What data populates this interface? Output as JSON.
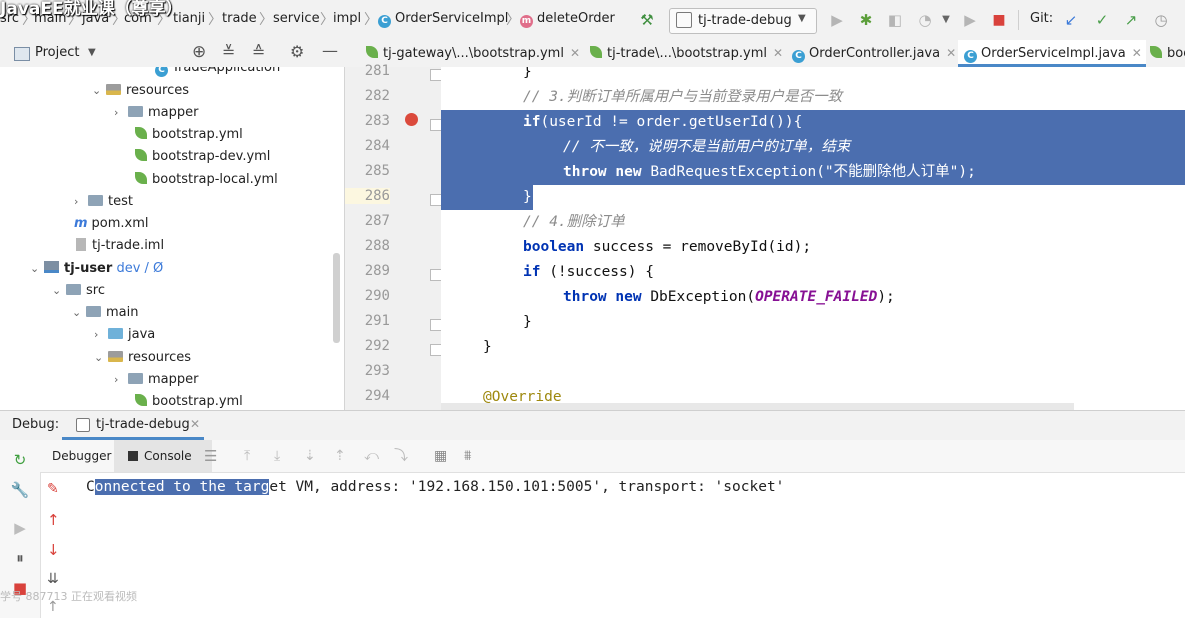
{
  "watermark": "JavaEE就业课（尊享）",
  "breadcrumb": [
    "src",
    "main",
    "java",
    "com",
    "tianji",
    "trade",
    "service",
    "impl",
    "OrderServiceImpl",
    "deleteOrder"
  ],
  "run_config": "tj-trade-debug",
  "vcs_label": "Git:",
  "project_panel": {
    "title": "Project",
    "tree": [
      {
        "label": "TradeApplication",
        "depth": 6
      },
      {
        "label": "resources",
        "depth": 5
      },
      {
        "label": "mapper",
        "depth": 6
      },
      {
        "label": "bootstrap.yml",
        "depth": 6
      },
      {
        "label": "bootstrap-dev.yml",
        "depth": 6
      },
      {
        "label": "bootstrap-local.yml",
        "depth": 6
      },
      {
        "label": "test",
        "depth": 4
      },
      {
        "label": "pom.xml",
        "depth": 3
      },
      {
        "label": "tj-trade.iml",
        "depth": 3
      },
      {
        "label": "tj-user",
        "depth": 1,
        "branch": "dev / Ø"
      },
      {
        "label": "src",
        "depth": 2
      },
      {
        "label": "main",
        "depth": 3
      },
      {
        "label": "java",
        "depth": 4
      },
      {
        "label": "resources",
        "depth": 4
      },
      {
        "label": "mapper",
        "depth": 5
      },
      {
        "label": "bootstrap.yml",
        "depth": 5
      }
    ]
  },
  "editor_tabs": [
    {
      "label": "tj-gateway\\...\\bootstrap.yml",
      "active": false
    },
    {
      "label": "tj-trade\\...\\bootstrap.yml",
      "active": false
    },
    {
      "label": "OrderController.java",
      "active": false
    },
    {
      "label": "OrderServiceImpl.java",
      "active": true
    },
    {
      "label": "boo",
      "active": false
    }
  ],
  "code": {
    "line_numbers": [
      "281",
      "282",
      "283",
      "284",
      "285",
      "286",
      "287",
      "288",
      "289",
      "290",
      "291",
      "292",
      "293",
      "294"
    ],
    "l281": "}",
    "l282": "// 3.判断订单所属用户与当前登录用户是否一致",
    "l283_kw": "if",
    "l283_rest": "(userId != order.getUserId()){",
    "l284": "// 不一致，说明不是当前用户的订单，结束",
    "l285_kw1": "throw",
    "l285_kw2": "new",
    "l285_rest": "BadRequestException(\"不能删除他人订单\");",
    "l286": "}",
    "l287": "// 4.删除订单",
    "l288_kw": "boolean",
    "l288_rest": "success = removeById(id);",
    "l289_kw": "if",
    "l289_rest": "(!success) {",
    "l290_kw1": "throw",
    "l290_kw2": "new",
    "l290_cls": "DbException(",
    "l290_const": "OPERATE_FAILED",
    "l290_end": ");",
    "l291": "}",
    "l292": "}",
    "l294": "@Override"
  },
  "debug": {
    "label": "Debug:",
    "session_tab": "tj-trade-debug",
    "tab_debugger": "Debugger",
    "tab_console": "Console",
    "console_selected": "onnected to the targ",
    "console_prefix": "C",
    "console_rest": "et VM, address: '192.168.150.101:5005', transport: 'socket'"
  },
  "overlay_viewers": "学号 887713 正在观看视频"
}
